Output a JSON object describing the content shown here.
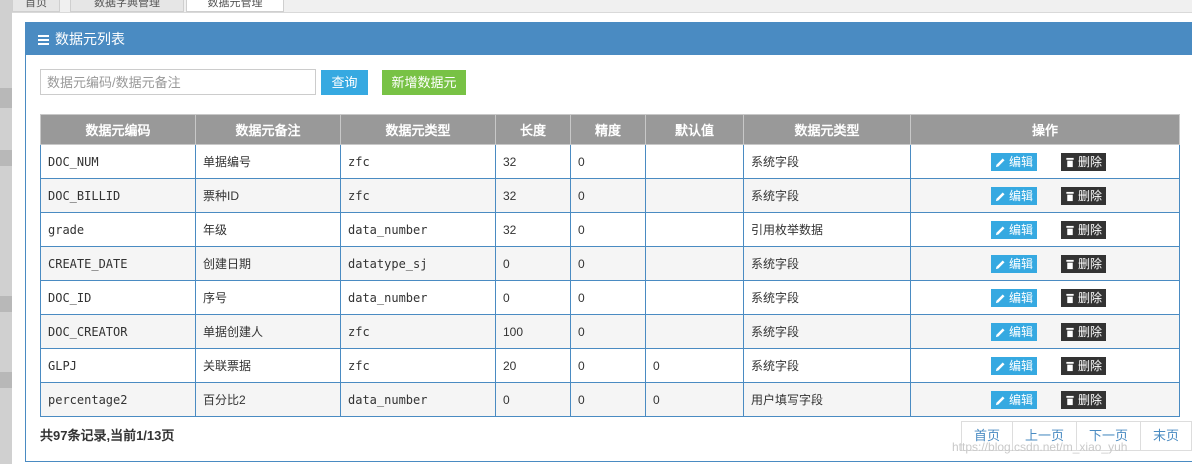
{
  "tabs": [
    {
      "label": "首页"
    },
    {
      "label": "数据字典管理"
    },
    {
      "label": "数据元管理"
    }
  ],
  "panel": {
    "title": "数据元列表",
    "icon": "menu-icon"
  },
  "search": {
    "placeholder": "数据元编码/数据元备注",
    "value": ""
  },
  "buttons": {
    "query": "查询",
    "add": "新增数据元"
  },
  "table": {
    "headers": [
      "数据元编码",
      "数据元备注",
      "数据元类型",
      "长度",
      "精度",
      "默认值",
      "数据元类型",
      "操作"
    ],
    "rows": [
      {
        "code": "DOC_NUM",
        "remark": "单据编号",
        "type": "zfc",
        "length": "32",
        "precision": "0",
        "default": "",
        "category": "系统字段"
      },
      {
        "code": "DOC_BILLID",
        "remark": "票种ID",
        "type": "zfc",
        "length": "32",
        "precision": "0",
        "default": "",
        "category": "系统字段"
      },
      {
        "code": "grade",
        "remark": "年级",
        "type": "data_number",
        "length": "32",
        "precision": "0",
        "default": "",
        "category": "引用枚举数据"
      },
      {
        "code": "CREATE_DATE",
        "remark": "创建日期",
        "type": "datatype_sj",
        "length": "0",
        "precision": "0",
        "default": "",
        "category": "系统字段"
      },
      {
        "code": "DOC_ID",
        "remark": "序号",
        "type": "data_number",
        "length": "0",
        "precision": "0",
        "default": "",
        "category": "系统字段"
      },
      {
        "code": "DOC_CREATOR",
        "remark": "单据创建人",
        "type": "zfc",
        "length": "100",
        "precision": "0",
        "default": "",
        "category": "系统字段"
      },
      {
        "code": "GLPJ",
        "remark": "关联票据",
        "type": "zfc",
        "length": "20",
        "precision": "0",
        "default": "0",
        "category": "系统字段"
      },
      {
        "code": "percentage2",
        "remark": "百分比2",
        "type": "data_number",
        "length": "0",
        "precision": "0",
        "default": "0",
        "category": "用户填写字段"
      }
    ],
    "edit_label": "编辑",
    "delete_label": "删除"
  },
  "summary": "共97条记录,当前1/13页",
  "pager": [
    "首页",
    "上一页",
    "下一页",
    "末页"
  ],
  "watermark": "https://blog.csdn.net/m_xiao_yuh",
  "colors": {
    "header_blue": "#4a8bc2",
    "query_button": "#36a9e1",
    "add_button": "#78c245",
    "table_header": "#999999",
    "delete_button": "#333333"
  }
}
